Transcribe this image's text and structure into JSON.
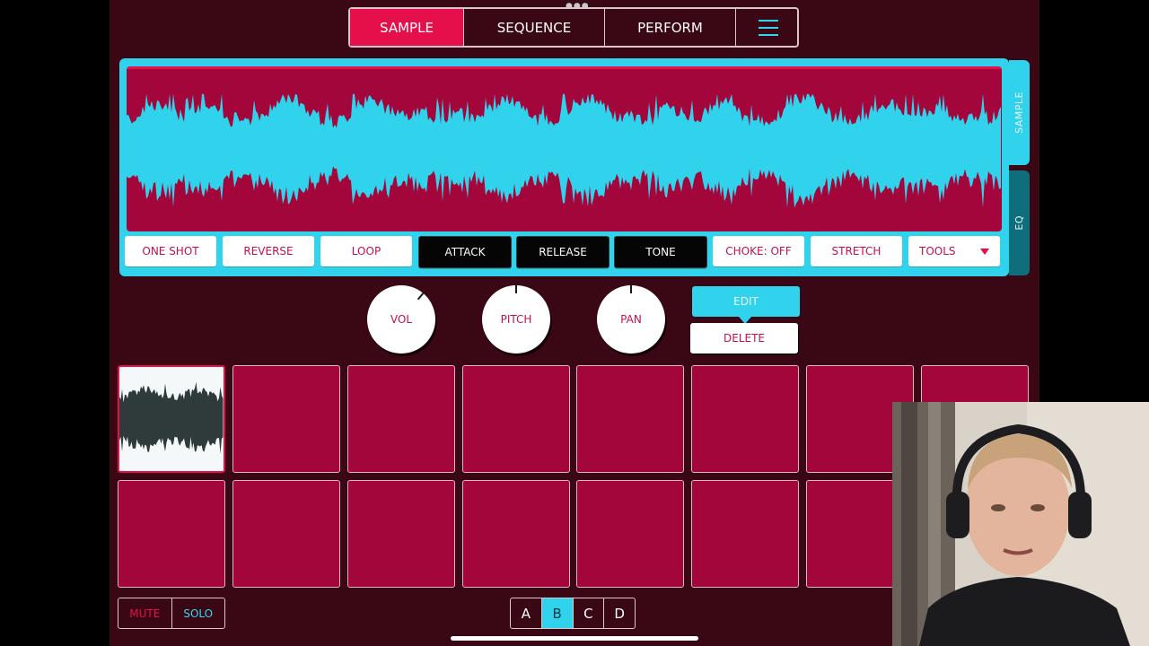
{
  "tabs": [
    {
      "label": "SAMPLE",
      "active": true
    },
    {
      "label": "SEQUENCE",
      "active": false
    },
    {
      "label": "PERFORM",
      "active": false
    }
  ],
  "side_tabs": {
    "sample": "SAMPLE",
    "eq": "EQ"
  },
  "sample_buttons": [
    {
      "label": "ONE SHOT",
      "style": "light"
    },
    {
      "label": "REVERSE",
      "style": "light"
    },
    {
      "label": "LOOP",
      "style": "light"
    },
    {
      "label": "ATTACK",
      "style": "dark"
    },
    {
      "label": "RELEASE",
      "style": "dark"
    },
    {
      "label": "TONE",
      "style": "dark"
    },
    {
      "label": "CHOKE: OFF",
      "style": "light"
    },
    {
      "label": "STRETCH",
      "style": "light"
    },
    {
      "label": "TOOLS",
      "style": "light"
    }
  ],
  "knobs": {
    "vol": "VOL",
    "pitch": "PITCH",
    "pan": "PAN"
  },
  "actions": {
    "edit": "EDIT",
    "delete": "DELETE"
  },
  "mute_solo": {
    "mute": "MUTE",
    "solo": "SOLO"
  },
  "banks": [
    {
      "label": "A",
      "active": false
    },
    {
      "label": "B",
      "active": true
    },
    {
      "label": "C",
      "active": false
    },
    {
      "label": "D",
      "active": false
    }
  ],
  "colors": {
    "background": "#3a0714",
    "accent_red": "#e5104b",
    "accent_cyan": "#31d3ec",
    "pad": "#a3063b"
  },
  "icons": {
    "menu": "hamburger-icon",
    "tools_dropdown": "caret-down-icon"
  }
}
